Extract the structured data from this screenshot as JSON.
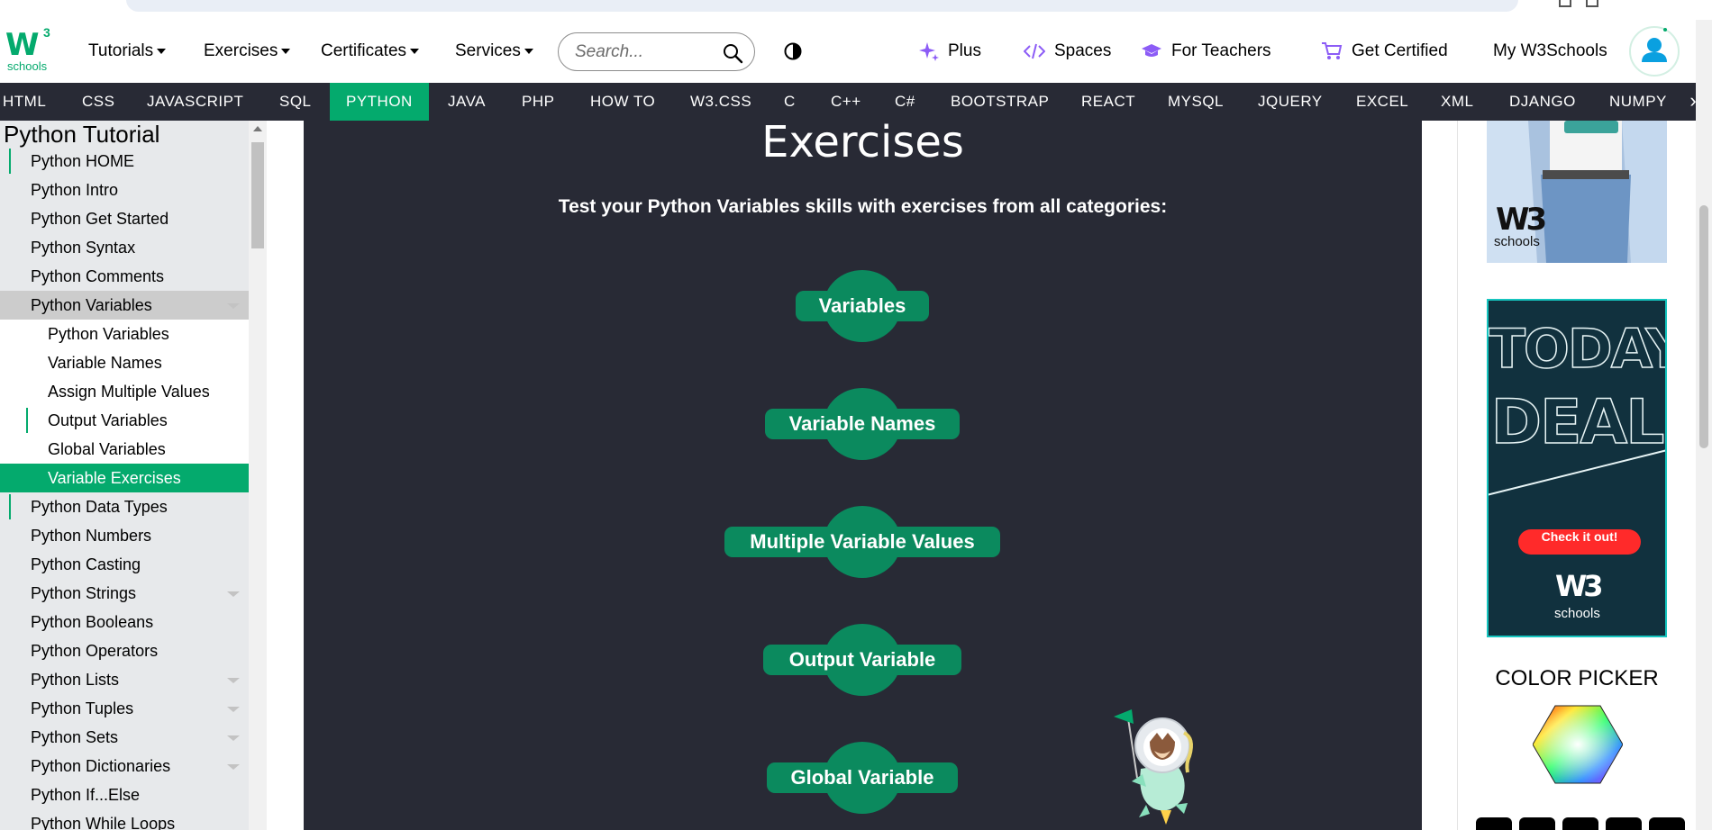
{
  "logo": {
    "mark": "W",
    "superscript": "3",
    "wordmark": "schools"
  },
  "topnav": {
    "menus": [
      "Tutorials",
      "Exercises",
      "Certificates",
      "Services"
    ],
    "search_placeholder": "Search...",
    "links": {
      "plus": "Plus",
      "spaces": "Spaces",
      "teachers": "For Teachers",
      "certified": "Get Certified",
      "my": "My W3Schools"
    }
  },
  "langbar": {
    "tabs": [
      "HTML",
      "CSS",
      "JAVASCRIPT",
      "SQL",
      "PYTHON",
      "JAVA",
      "PHP",
      "HOW TO",
      "W3.CSS",
      "C",
      "C++",
      "C#",
      "BOOTSTRAP",
      "REACT",
      "MYSQL",
      "JQUERY",
      "EXCEL",
      "XML",
      "DJANGO",
      "NUMPY"
    ],
    "active": "PYTHON",
    "next_glyph": "›"
  },
  "sidebar": {
    "title": "Python Tutorial",
    "items": [
      "Python HOME",
      "Python Intro",
      "Python Get Started",
      "Python Syntax",
      "Python Comments",
      "Python Variables",
      "Python Variables",
      "Variable Names",
      "Assign Multiple Values",
      "Output Variables",
      "Global Variables",
      "Variable Exercises",
      "Python Data Types",
      "Python Numbers",
      "Python Casting",
      "Python Strings",
      "Python Booleans",
      "Python Operators",
      "Python Lists",
      "Python Tuples",
      "Python Sets",
      "Python Dictionaries",
      "Python If...Else",
      "Python While Loops"
    ]
  },
  "main": {
    "heading": "Exercises",
    "lead": "Test your Python Variables skills with exercises from all categories:",
    "exercises": [
      "Variables",
      "Variable Names",
      "Multiple Variable Values",
      "Output Variable",
      "Global Variable"
    ]
  },
  "right": {
    "ad1_brand": "schools",
    "ad1_mark": "W3",
    "ad2_line1": "TODAY'S",
    "ad2_line2": "DEAL",
    "ad2_button": "Check it out!",
    "ad2_brand": "schools",
    "ad2_mark": "W3",
    "colorpicker": "COLOR PICKER"
  },
  "colors": {
    "brand": "#04AA6D",
    "navbar_dark": "#282A35",
    "exercise_green": "#0b8a5e",
    "sidebar_bg": "#E7E9EB",
    "accent_purple": "#8c5cf6"
  }
}
